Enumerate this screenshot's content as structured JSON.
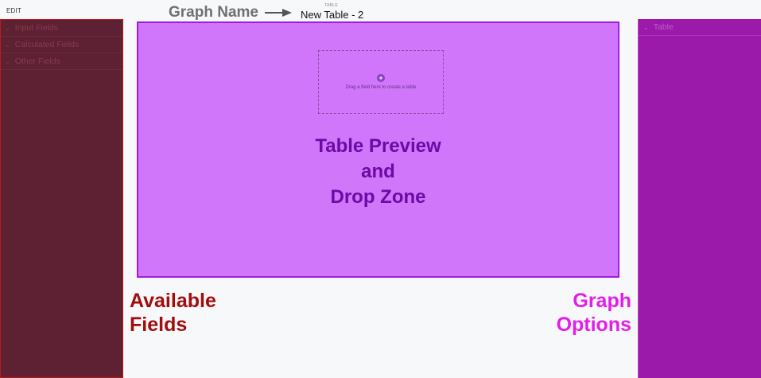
{
  "header": {
    "edit_label": "EDIT",
    "graph_name_annotation": "Graph Name",
    "kicker": "TABLE",
    "table_name": "New Table - 2"
  },
  "fields_panel": {
    "groups": [
      {
        "label": "Input Fields"
      },
      {
        "label": "Calculated Fields"
      },
      {
        "label": "Other Fields"
      }
    ]
  },
  "preview": {
    "drop_hint": "Drag a field here to create a table",
    "annotation_lines": [
      "Table Preview",
      "and",
      "Drop Zone"
    ]
  },
  "options_panel": {
    "groups": [
      {
        "label": "Table"
      }
    ]
  },
  "annotations": {
    "fields_lines": [
      "Available",
      "Fields"
    ],
    "options_lines": [
      "Graph",
      "Options"
    ]
  },
  "colors": {
    "fields_panel_bg": "#5e2033",
    "fields_panel_border": "#c21818",
    "preview_bg": "#cf76fb",
    "preview_border": "#a01adf",
    "options_panel_bg": "#9b1aa9",
    "fields_annotation": "#a10d0d",
    "options_annotation": "#e21ee8",
    "preview_annotation": "#6c0aa6"
  }
}
